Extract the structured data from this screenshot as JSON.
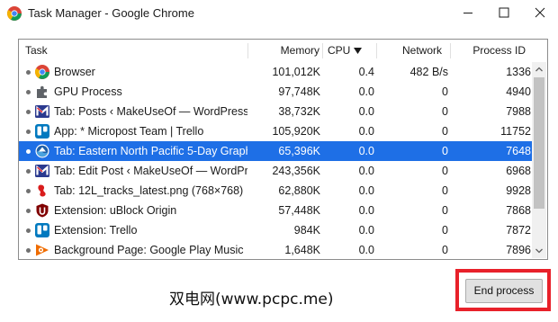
{
  "window": {
    "title": "Task Manager - Google Chrome",
    "controls": {
      "minimize": "minimize-icon",
      "maximize": "maximize-icon",
      "close": "close-icon"
    }
  },
  "columns": {
    "task": "Task",
    "memory": "Memory",
    "cpu": "CPU",
    "network": "Network",
    "pid": "Process ID",
    "sort": {
      "column": "cpu",
      "direction": "descending"
    }
  },
  "rows": [
    {
      "icon": "chrome-icon",
      "task": "Browser",
      "memory": "101,012K",
      "cpu": "0.4",
      "network": "482 B/s",
      "pid": "1336",
      "selected": false
    },
    {
      "icon": "puzzle-icon",
      "task": "GPU Process",
      "memory": "97,748K",
      "cpu": "0.0",
      "network": "0",
      "pid": "4940",
      "selected": false
    },
    {
      "icon": "makeuseof-icon",
      "task": "Tab: Posts ‹ MakeUseOf — WordPress",
      "memory": "38,732K",
      "cpu": "0.0",
      "network": "0",
      "pid": "7988",
      "selected": false
    },
    {
      "icon": "trello-icon",
      "task": "App: * Micropost Team | Trello",
      "memory": "105,920K",
      "cpu": "0.0",
      "network": "0",
      "pid": "11752",
      "selected": false
    },
    {
      "icon": "noaa-icon",
      "task": "Tab: Eastern North Pacific 5-Day Graph...",
      "memory": "65,396K",
      "cpu": "0.0",
      "network": "0",
      "pid": "7648",
      "selected": true
    },
    {
      "icon": "makeuseof-icon",
      "task": "Tab: Edit Post ‹ MakeUseOf — WordPr...",
      "memory": "243,356K",
      "cpu": "0.0",
      "network": "0",
      "pid": "6968",
      "selected": false
    },
    {
      "icon": "image-tab-icon",
      "task": "Tab: 12L_tracks_latest.png (768×768)",
      "memory": "62,880K",
      "cpu": "0.0",
      "network": "0",
      "pid": "9928",
      "selected": false
    },
    {
      "icon": "ublock-icon",
      "task": "Extension: uBlock Origin",
      "memory": "57,448K",
      "cpu": "0.0",
      "network": "0",
      "pid": "7868",
      "selected": false
    },
    {
      "icon": "trello-icon",
      "task": "Extension: Trello",
      "memory": "984K",
      "cpu": "0.0",
      "network": "0",
      "pid": "7872",
      "selected": false
    },
    {
      "icon": "play-music-icon",
      "task": "Background Page: Google Play Music",
      "memory": "1,648K",
      "cpu": "0.0",
      "network": "0",
      "pid": "7896",
      "selected": false
    }
  ],
  "buttons": {
    "end_process": "End process"
  },
  "watermark": "双电网(www.pcpc.me)",
  "colors": {
    "selection": "#1e6fe6",
    "highlight_frame": "#e8212a"
  }
}
